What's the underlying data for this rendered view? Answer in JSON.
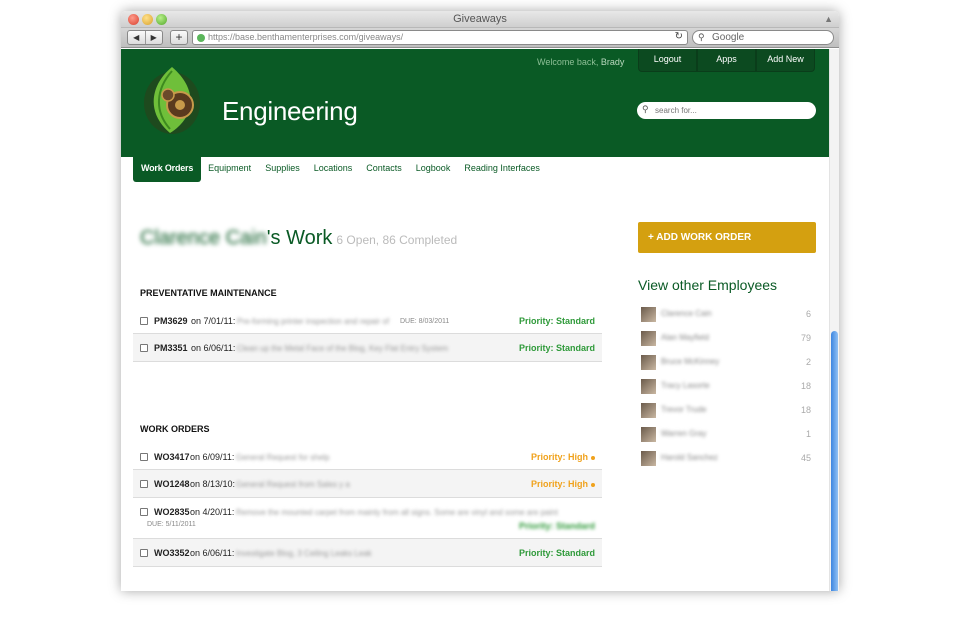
{
  "browser": {
    "window_title": "Giveaways",
    "url": "https://base.benthamenterprises.com/giveaways/",
    "search_placeholder": "Google"
  },
  "header": {
    "site_title": "Engineering",
    "welcome_prefix": "Welcome back,",
    "welcome_user": "Brady",
    "buttons": {
      "logout": "Logout",
      "apps": "Apps",
      "add_new": "Add New"
    },
    "search_placeholder": "search for..."
  },
  "nav": {
    "items": [
      "Work Orders",
      "Equipment",
      "Supplies",
      "Locations",
      "Contacts",
      "Logbook",
      "Reading Interfaces"
    ]
  },
  "heading": {
    "employee_name": "Clarence Cain",
    "suffix": "'s Work",
    "counts": "6 Open, 86 Completed"
  },
  "preventative": {
    "title": "PREVENTATIVE MAINTENANCE",
    "rows": [
      {
        "id": "PM3629",
        "on": "on 7/01/11:",
        "desc": "Pre-forming printer inspection and repair of",
        "due": "DUE: 8/03/2011",
        "priority": "Priority: Standard"
      },
      {
        "id": "PM3351",
        "on": "on 6/06/11:",
        "desc": "Clean up the Metal Face of the Blog, Key Flat Entry System",
        "priority": "Priority: Standard"
      }
    ]
  },
  "work_orders": {
    "title": "WORK ORDERS",
    "rows": [
      {
        "id": "WO3417",
        "on": "on 6/09/11:",
        "desc": "General Request for shelp",
        "priority": "Priority: High"
      },
      {
        "id": "WO1248",
        "on": "on 8/13/10:",
        "desc": "General Request from Sales y a",
        "priority": "Priority: High"
      },
      {
        "id": "WO2835",
        "on": "on 4/20/11:",
        "desc": "Remove the mounted carpet from mainly from all signs. Some are vinyl and some are paint",
        "due": "DUE: 5/11/2011",
        "priority": "Priority: Standard"
      },
      {
        "id": "WO3352",
        "on": "on 6/06/11:",
        "desc": "Investigate Blog, 3 Ceiling Leaks Leak",
        "priority": "Priority: Standard"
      }
    ]
  },
  "sidebar": {
    "add_button": "+ ADD WORK ORDER",
    "title": "View other Employees",
    "employees": [
      {
        "name": "Clarence Cain",
        "count": "6"
      },
      {
        "name": "Alan Mayfield",
        "count": "79"
      },
      {
        "name": "Bruce McKinney",
        "count": "2"
      },
      {
        "name": "Tracy Lasorte",
        "count": "18"
      },
      {
        "name": "Trevor Trude",
        "count": "18"
      },
      {
        "name": "Warren Gray",
        "count": "1"
      },
      {
        "name": "Harold Sanchez",
        "count": "45"
      }
    ]
  },
  "colors": {
    "brand_green": "#0a5a25",
    "accent_gold": "#d4a010",
    "priority_standard": "#2f9a3a",
    "priority_high": "#f0a21c"
  }
}
